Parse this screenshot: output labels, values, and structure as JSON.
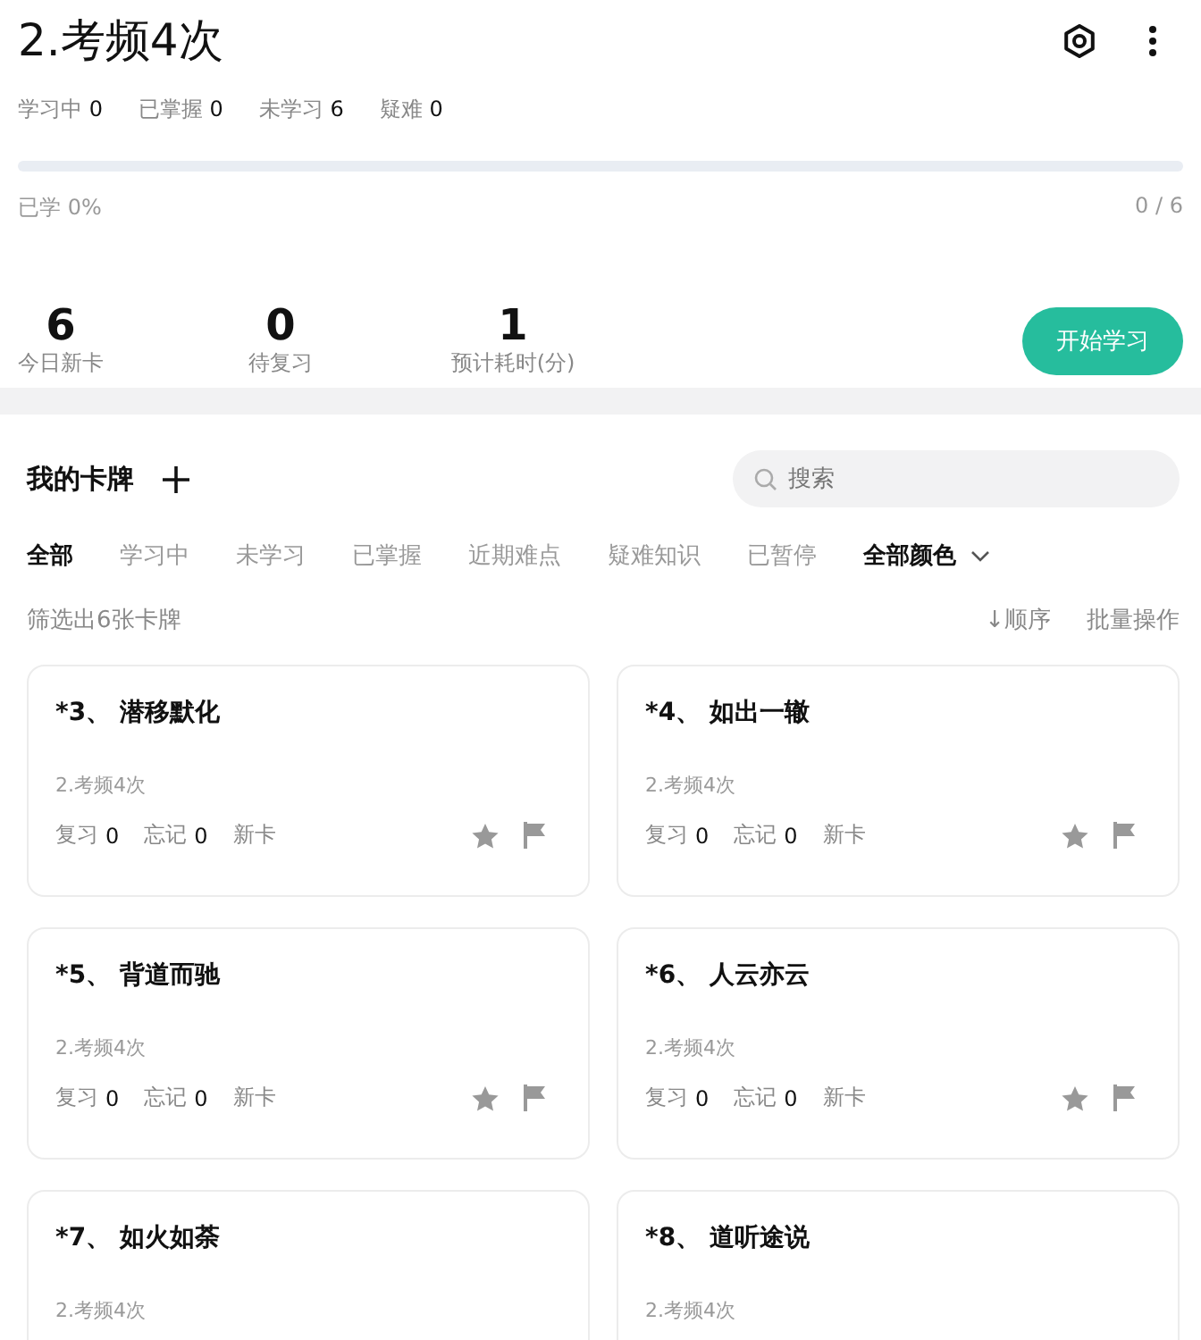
{
  "header": {
    "title": "2.考频4次"
  },
  "stats": [
    {
      "label": "学习中",
      "count": "0"
    },
    {
      "label": "已掌握",
      "count": "0"
    },
    {
      "label": "未学习",
      "count": "6"
    },
    {
      "label": "疑难",
      "count": "0"
    }
  ],
  "progress": {
    "level": 0,
    "label": "已学 0%",
    "reading": "0 / 6"
  },
  "summary": [
    {
      "value": "6",
      "label": "今日新卡"
    },
    {
      "value": "0",
      "label": "待复习"
    },
    {
      "value": "1",
      "label": "预计耗时(分)"
    }
  ],
  "start_button": "开始学习",
  "my_cards": {
    "title": "我的卡牌",
    "search": {
      "placeholder": "搜索"
    }
  },
  "filters": [
    {
      "label": "全部",
      "selected": true
    },
    {
      "label": "学习中",
      "selected": false
    },
    {
      "label": "未学习",
      "selected": false
    },
    {
      "label": "已掌握",
      "selected": false
    },
    {
      "label": "近期难点",
      "selected": false
    },
    {
      "label": "疑难知识",
      "selected": false
    },
    {
      "label": "已暂停",
      "selected": false
    }
  ],
  "color_filter": "全部颜色",
  "result_count": "筛选出6张卡牌",
  "sort": "↓顺序",
  "batch": "批量操作",
  "cards": [
    {
      "title": "*3、 潜移默化",
      "deck": "2.考频4次",
      "review": "复习",
      "review_count": "0",
      "forget": "忘记",
      "forget_count": "0",
      "status": "新卡"
    },
    {
      "title": "*4、 如出一辙",
      "deck": "2.考频4次",
      "review": "复习",
      "review_count": "0",
      "forget": "忘记",
      "forget_count": "0",
      "status": "新卡"
    },
    {
      "title": "*5、 背道而驰",
      "deck": "2.考频4次",
      "review": "复习",
      "review_count": "0",
      "forget": "忘记",
      "forget_count": "0",
      "status": "新卡"
    },
    {
      "title": "*6、 人云亦云",
      "deck": "2.考频4次",
      "review": "复习",
      "review_count": "0",
      "forget": "忘记",
      "forget_count": "0",
      "status": "新卡"
    },
    {
      "title": "*7、 如火如荼",
      "deck": "2.考频4次"
    },
    {
      "title": "*8、 道听途说",
      "deck": "2.考频4次"
    }
  ]
}
